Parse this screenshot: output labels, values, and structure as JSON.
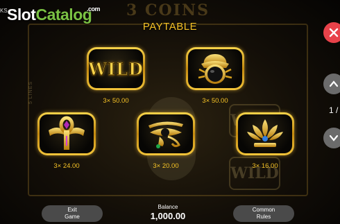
{
  "logo": {
    "part1": "Slot",
    "part2": "Catalog",
    "domain": ".com"
  },
  "corner_text": "KS",
  "background": {
    "title": "3 COINS",
    "lines_label": "5 LINES",
    "ghost_wild": "WILD"
  },
  "paytable": {
    "title": "PAYTABLE",
    "symbols": [
      {
        "id": "wild",
        "label": "WILD",
        "multiplier": "3×",
        "value": "50.00"
      },
      {
        "id": "scarab",
        "multiplier": "3×",
        "value": "50.00"
      },
      {
        "id": "ankh",
        "multiplier": "3×",
        "value": "24.00"
      },
      {
        "id": "eye-of-horus",
        "multiplier": "3×",
        "value": "20.00"
      },
      {
        "id": "lotus",
        "multiplier": "3×",
        "value": "16.00"
      }
    ]
  },
  "footer": {
    "exit_line1": "Exit",
    "exit_line2": "Game",
    "balance_label": "Balance",
    "balance_value": "1,000.00",
    "rules_line1": "Common",
    "rules_line2": "Rules"
  },
  "nav": {
    "page_indicator": "1 /"
  },
  "colors": {
    "gold": "#f5c226",
    "close": "#e8424a",
    "button": "#4a4a4a",
    "logo_green": "#7ac143"
  },
  "icons": [
    "close-icon",
    "chevron-up-icon",
    "chevron-down-icon"
  ]
}
